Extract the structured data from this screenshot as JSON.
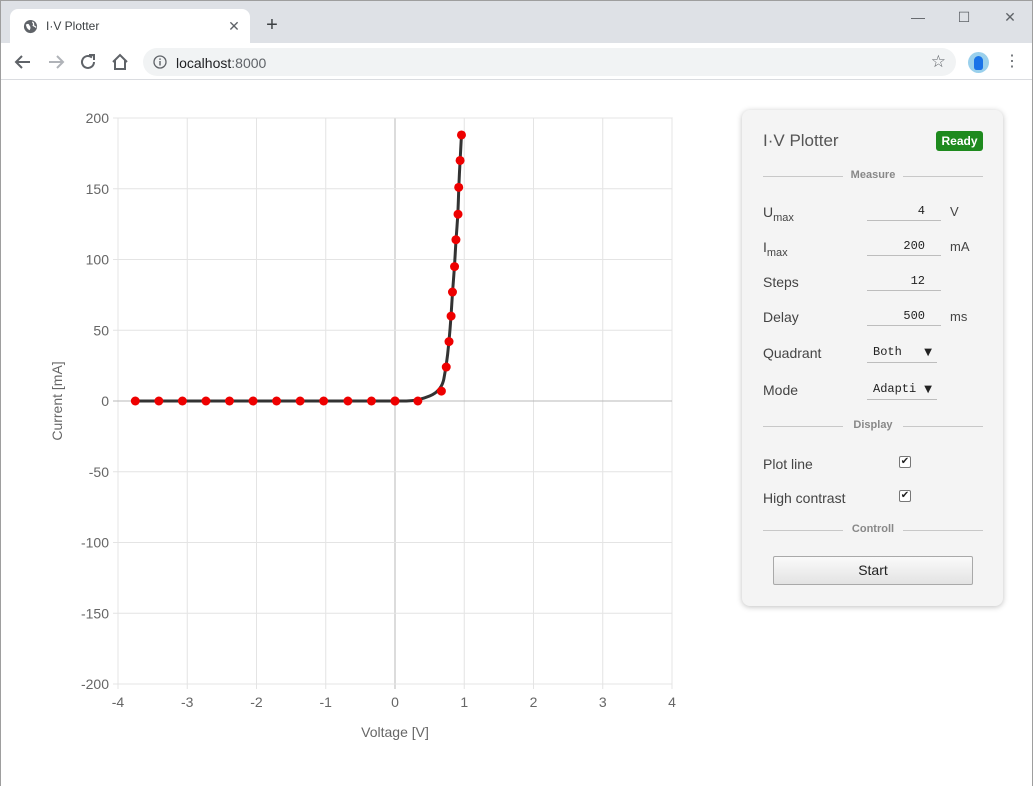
{
  "browser": {
    "tab_title": "I·V Plotter",
    "tab_close": "✕",
    "new_tab": "+",
    "url_host": "localhost",
    "url_port": ":8000",
    "window_controls": {
      "minimize": "—",
      "maximize": "☐",
      "close": "✕"
    },
    "star": "☆",
    "menu": "⋮"
  },
  "panel": {
    "title": "I·V Plotter",
    "status": "Ready",
    "status_color": "#1e8a1e",
    "sections": {
      "measure": "Measure",
      "display": "Display",
      "control": "Controll"
    },
    "fields": {
      "umax": {
        "label": "U",
        "sub": "max",
        "value": "4",
        "unit": "V"
      },
      "imax": {
        "label": "I",
        "sub": "max",
        "value": "200",
        "unit": "mA"
      },
      "steps": {
        "label": "Steps",
        "value": "12"
      },
      "delay": {
        "label": "Delay",
        "value": "500",
        "unit": "ms"
      },
      "quadrant": {
        "label": "Quadrant",
        "value": "Both"
      },
      "mode": {
        "label": "Mode",
        "value": "Adapti"
      }
    },
    "display": {
      "plot_line": {
        "label": "Plot line",
        "checked": true
      },
      "high_contrast": {
        "label": "High contrast",
        "checked": true
      }
    },
    "start_label": "Start"
  },
  "chart_data": {
    "type": "scatter",
    "xlabel": "Voltage [V]",
    "ylabel": "Current [mA]",
    "xlim": [
      -4,
      4
    ],
    "ylim": [
      -200,
      200
    ],
    "xticks": [
      -4,
      -3,
      -2,
      -1,
      0,
      1,
      2,
      3,
      4
    ],
    "yticks": [
      200,
      150,
      100,
      50,
      0,
      -50,
      -100,
      -150,
      -200
    ],
    "grid": true,
    "line_color": "#333333",
    "marker_color": "#ee0000",
    "points": [
      [
        -3.75,
        0
      ],
      [
        -3.41,
        0
      ],
      [
        -3.07,
        0
      ],
      [
        -2.73,
        0
      ],
      [
        -2.39,
        0
      ],
      [
        -2.05,
        0
      ],
      [
        -1.71,
        0
      ],
      [
        -1.37,
        0
      ],
      [
        -1.03,
        0
      ],
      [
        -0.68,
        0
      ],
      [
        -0.34,
        0
      ],
      [
        0.0,
        0
      ],
      [
        0.0,
        0
      ],
      [
        0.33,
        0
      ],
      [
        0.67,
        7
      ],
      [
        0.74,
        24
      ],
      [
        0.78,
        42
      ],
      [
        0.81,
        60
      ],
      [
        0.83,
        77
      ],
      [
        0.86,
        95
      ],
      [
        0.88,
        114
      ],
      [
        0.91,
        132
      ],
      [
        0.92,
        151
      ],
      [
        0.94,
        170
      ],
      [
        0.96,
        188
      ]
    ]
  }
}
